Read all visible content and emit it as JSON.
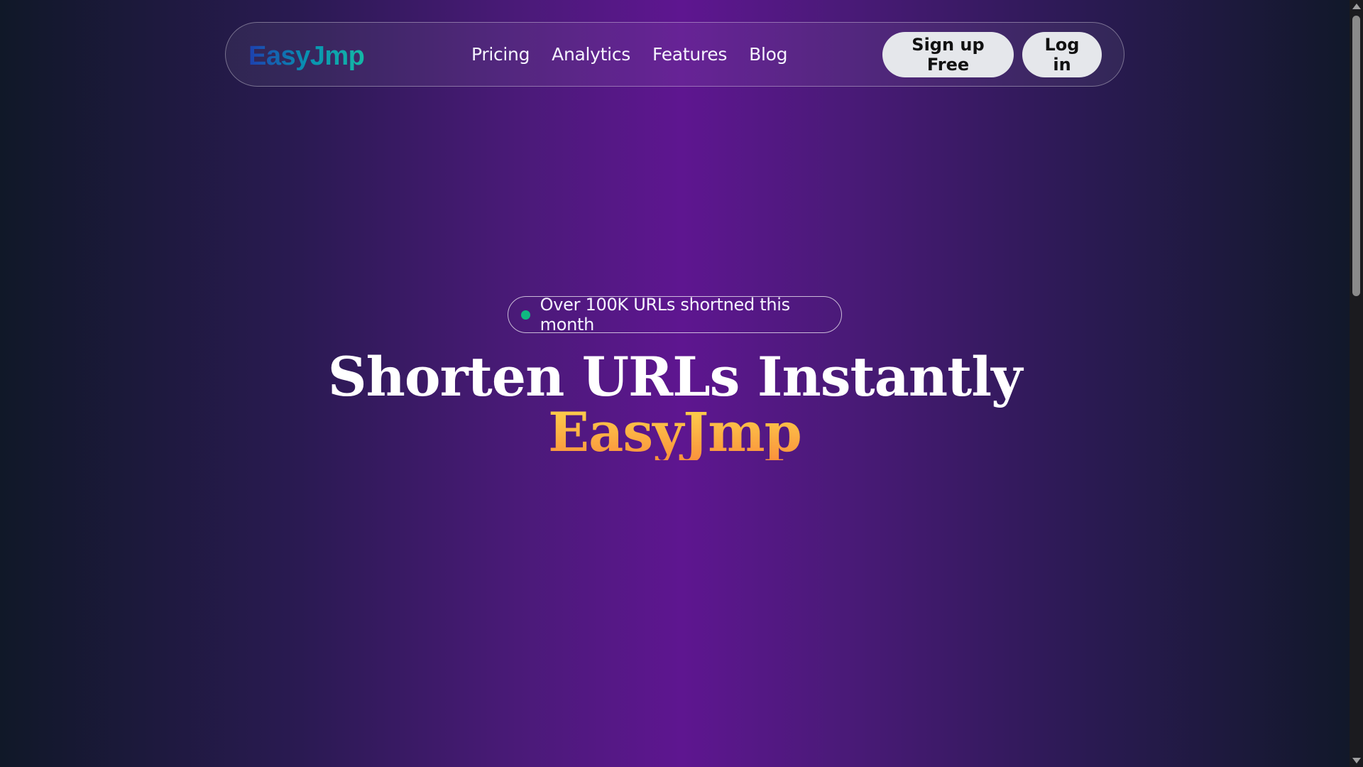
{
  "nav": {
    "logo": "EasyJmp",
    "links": [
      "Pricing",
      "Analytics",
      "Features",
      "Blog"
    ],
    "signup_label": "Sign up Free",
    "login_label": "Log in"
  },
  "hero": {
    "badge_text": "Over 100K URLs shortned this month",
    "title_line1": "Shorten URLs Instantly",
    "title_line2": "EasyJmp"
  },
  "colors": {
    "accent_gold": "#fbbf24",
    "badge_dot": "#10b981",
    "logo_gradient_start": "#1e40af",
    "logo_gradient_end": "#14b8a6"
  }
}
